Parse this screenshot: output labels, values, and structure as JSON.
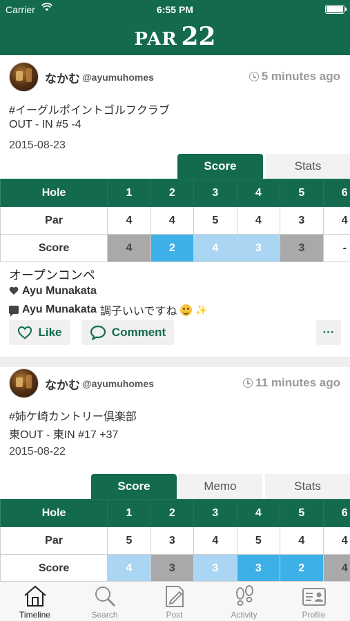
{
  "status_bar": {
    "carrier": "Carrier",
    "time": "6:55 PM"
  },
  "app": {
    "logo_par": "PAR",
    "logo_num": "22"
  },
  "posts": [
    {
      "username": "なかむ",
      "handle": "@ayumuhomes",
      "time_ago": "5 minutes ago",
      "course": "#イーグルポイントゴルフクラブ",
      "round": "OUT - IN #5 -4",
      "date": "2015-08-23",
      "tabs": [
        "Score",
        "Stats"
      ],
      "active_tab": "Score",
      "table": {
        "hole_label": "Hole",
        "par_label": "Par",
        "score_label": "Score",
        "holes": [
          "1",
          "2",
          "3",
          "4",
          "5",
          "6"
        ],
        "par": [
          "4",
          "4",
          "5",
          "4",
          "3",
          "4"
        ],
        "score": [
          "4",
          "2",
          "4",
          "3",
          "3",
          "-"
        ]
      },
      "competition": "オープンコンペ",
      "liked_by": "Ayu Munakata",
      "comment": {
        "author": "Ayu Munakata",
        "text": "調子いいですね"
      },
      "buttons": {
        "like": "Like",
        "comment": "Comment",
        "more": "···"
      }
    },
    {
      "username": "なかむ",
      "handle": "@ayumuhomes",
      "time_ago": "11 minutes ago",
      "course": "#姉ケ崎カントリー倶楽部",
      "round": "東OUT - 東IN #17 +37",
      "date": "2015-08-22",
      "tabs": [
        "Score",
        "Memo",
        "Stats"
      ],
      "active_tab": "Score",
      "table": {
        "hole_label": "Hole",
        "par_label": "Par",
        "score_label": "Score",
        "holes": [
          "1",
          "2",
          "3",
          "4",
          "5",
          "6"
        ],
        "par": [
          "5",
          "3",
          "4",
          "5",
          "4",
          "4"
        ],
        "score": [
          "4",
          "3",
          "3",
          "3",
          "2",
          "4"
        ]
      }
    }
  ],
  "tab_bar": [
    "Timeline",
    "Search",
    "Post",
    "Activity",
    "Profile"
  ],
  "colors": {
    "brand_green": "#136a4f",
    "birdie_blue": "#3db0e8",
    "par_light_blue": "#aad6f4",
    "bogey_gray": "#a9a9a9"
  }
}
